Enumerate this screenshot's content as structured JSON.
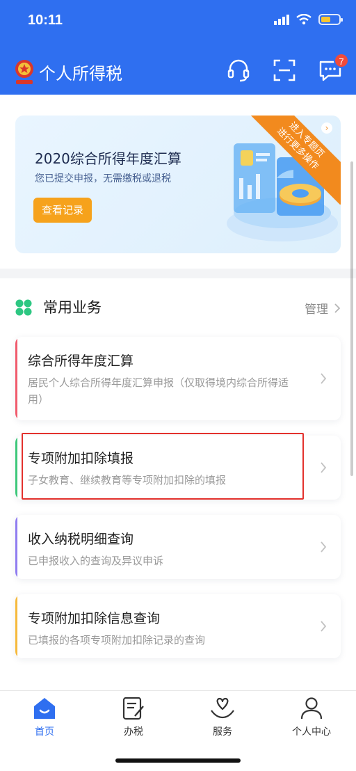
{
  "status": {
    "time": "10:11",
    "battery_level": 0.55
  },
  "header": {
    "title": "个人所得税",
    "message_badge": "7"
  },
  "banner": {
    "title": "2020综合所得年度汇算",
    "subtitle": "您已提交申报，无需缴税或退税",
    "button": "查看记录",
    "ribbon_line1": "进入专题页",
    "ribbon_line2": "进行更多操作"
  },
  "section": {
    "title": "常用业务",
    "manage": "管理"
  },
  "cards": [
    {
      "title": "综合所得年度汇算",
      "desc": "居民个人综合所得年度汇算申报（仅取得境内综合所得适用）",
      "accent": "#f05a6c"
    },
    {
      "title": "专项附加扣除填报",
      "desc": "子女教育、继续教育等专项附加扣除的填报",
      "accent": "#3cc77a"
    },
    {
      "title": "收入纳税明细查询",
      "desc": "已申报收入的查询及异议申诉",
      "accent": "#8f7cf0"
    },
    {
      "title": "专项附加扣除信息查询",
      "desc": "已填报的各项专项附加扣除记录的查询",
      "accent": "#f6b93b"
    }
  ],
  "tabs": [
    {
      "label": "首页",
      "icon": "home-icon",
      "active": true
    },
    {
      "label": "办税",
      "icon": "tax-form-icon",
      "active": false
    },
    {
      "label": "服务",
      "icon": "heart-hand-icon",
      "active": false
    },
    {
      "label": "个人中心",
      "icon": "person-icon",
      "active": false
    }
  ],
  "colors": {
    "primary": "#2f6ff0",
    "orange": "#f6a21c",
    "highlight": "#e3312d"
  }
}
